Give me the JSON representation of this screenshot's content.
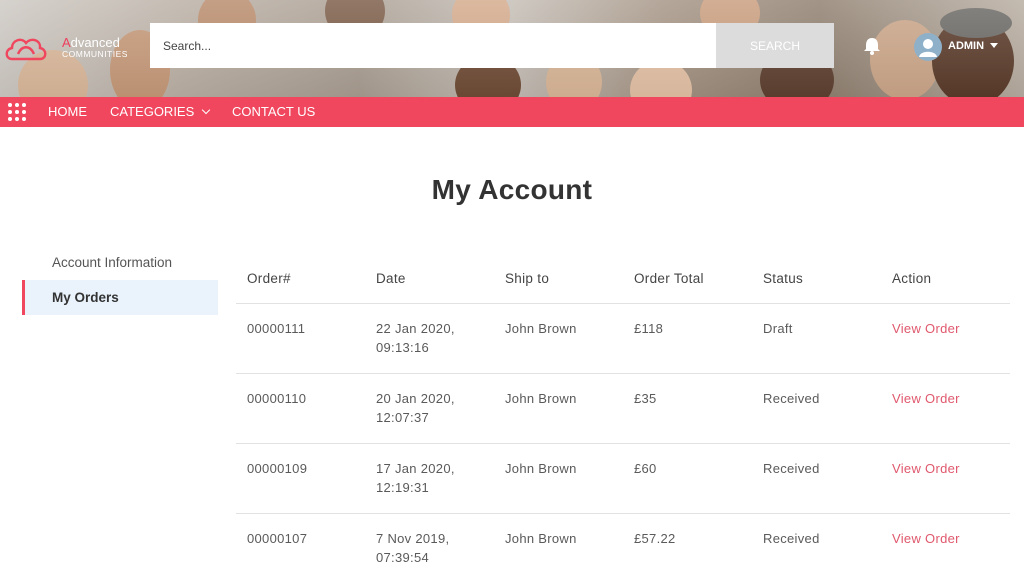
{
  "brand": {
    "line1_accent": "A",
    "line1_rest": "dvanced",
    "line2": "COMMUNITIES",
    "accent_color": "#f0465e"
  },
  "search": {
    "placeholder": "Search...",
    "button_label": "SEARCH"
  },
  "user": {
    "name": "ADMIN",
    "icons": [
      "bell-icon",
      "avatar-icon",
      "caret-down-icon"
    ]
  },
  "nav": {
    "items": [
      {
        "label": "HOME"
      },
      {
        "label": "CATEGORIES",
        "has_dropdown": true
      },
      {
        "label": "CONTACT US"
      }
    ]
  },
  "page": {
    "title": "My Account"
  },
  "sidebar": {
    "items": [
      {
        "label": "Account Information",
        "active": false
      },
      {
        "label": "My Orders",
        "active": true
      }
    ]
  },
  "orders": {
    "columns": [
      "Order#",
      "Date",
      "Ship to",
      "Order Total",
      "Status",
      "Action"
    ],
    "rows": [
      {
        "order": "00000111",
        "date_line1": "22 Jan 2020,",
        "date_line2": "09:13:16",
        "ship_to": "John Brown",
        "total": "£118",
        "status": "Draft",
        "action": "View Order"
      },
      {
        "order": "00000110",
        "date_line1": "20 Jan 2020,",
        "date_line2": "12:07:37",
        "ship_to": "John Brown",
        "total": "£35",
        "status": "Received",
        "action": "View Order"
      },
      {
        "order": "00000109",
        "date_line1": "17 Jan 2020,",
        "date_line2": "12:19:31",
        "ship_to": "John Brown",
        "total": "£60",
        "status": "Received",
        "action": "View Order"
      },
      {
        "order": "00000107",
        "date_line1": "7 Nov 2019,",
        "date_line2": "07:39:54",
        "ship_to": "John Brown",
        "total": "£57.22",
        "status": "Received",
        "action": "View Order"
      }
    ]
  }
}
